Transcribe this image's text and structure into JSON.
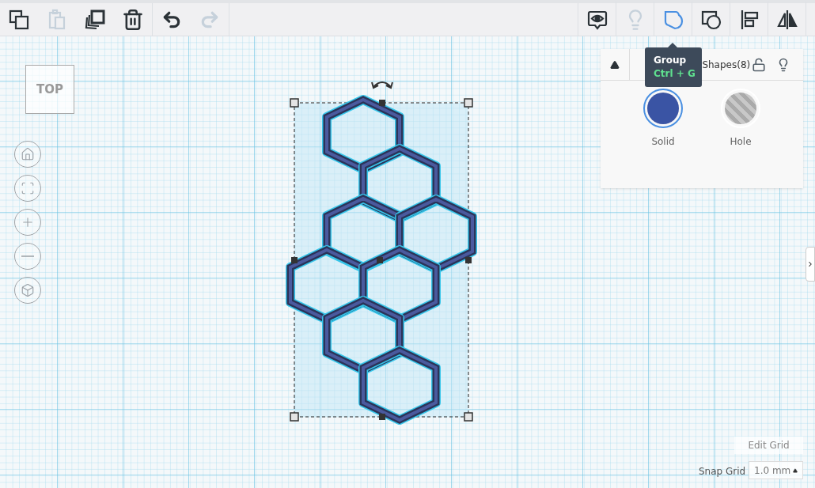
{
  "toolbar": {
    "left_groups": [
      [
        {
          "kind": "copy",
          "disabled": false
        },
        {
          "kind": "paste",
          "disabled": true
        },
        {
          "kind": "duplicate",
          "disabled": false
        },
        {
          "kind": "delete",
          "disabled": false
        }
      ],
      [
        {
          "kind": "undo",
          "disabled": false
        },
        {
          "kind": "redo",
          "disabled": true
        }
      ]
    ],
    "right_tools": [
      {
        "kind": "notes",
        "disabled": false,
        "selected": false
      },
      {
        "kind": "bulb",
        "disabled": true,
        "selected": false
      },
      {
        "kind": "group",
        "disabled": false,
        "selected": true
      },
      {
        "kind": "ungroup",
        "disabled": false,
        "selected": false
      },
      {
        "kind": "align",
        "disabled": false,
        "selected": false
      },
      {
        "kind": "mirror",
        "disabled": false,
        "selected": false
      }
    ]
  },
  "tooltip": {
    "title": "Group",
    "shortcut": "Ctrl + G"
  },
  "inspector": {
    "title": "Shapes(8)",
    "expanded": true,
    "locked": false,
    "options": [
      {
        "label": "Solid",
        "kind": "solid",
        "selected": true
      },
      {
        "label": "Hole",
        "kind": "hole",
        "selected": false
      }
    ]
  },
  "view_cube": {
    "label": "TOP"
  },
  "view_controls": [
    {
      "kind": "home"
    },
    {
      "kind": "fit"
    },
    {
      "kind": "zoom_in"
    },
    {
      "kind": "zoom_out"
    },
    {
      "kind": "perspective"
    }
  ],
  "edit_grid": {
    "label": "Edit Grid"
  },
  "snap_grid": {
    "label": "Snap Grid",
    "value": "1.0 mm"
  }
}
